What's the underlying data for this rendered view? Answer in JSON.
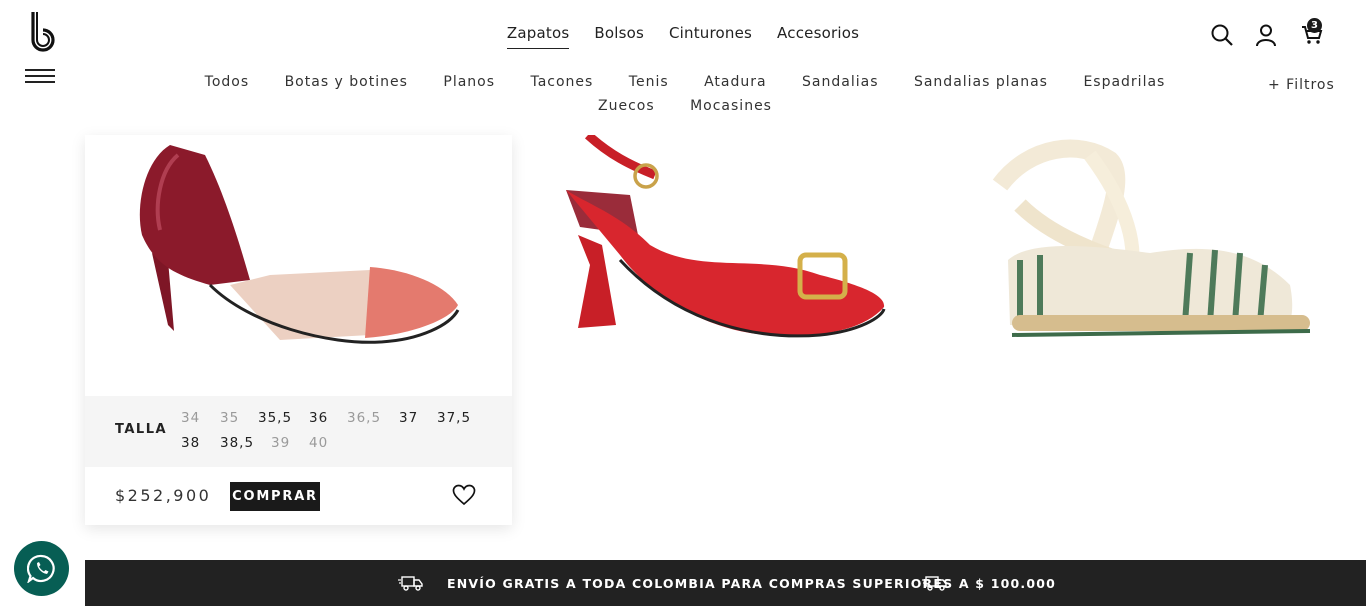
{
  "header": {
    "main_nav": [
      "Zapatos",
      "Bolsos",
      "Cinturones",
      "Accesorios"
    ],
    "active_main": "Zapatos",
    "sub_nav": [
      "Todos",
      "Botas y botines",
      "Planos",
      "Tacones",
      "Tenis",
      "Atadura",
      "Sandalias",
      "Sandalias planas",
      "Espadrilas",
      "Zuecos",
      "Mocasines"
    ],
    "filters_label": "+ Filtros",
    "cart_count": "3",
    "icons": [
      "search-icon",
      "user-icon",
      "cart-icon",
      "menu-icon"
    ]
  },
  "product": {
    "talla_label": "TALLA",
    "sizes": [
      {
        "label": "34",
        "available": false
      },
      {
        "label": "35",
        "available": false
      },
      {
        "label": "35,5",
        "available": true
      },
      {
        "label": "36",
        "available": true
      },
      {
        "label": "36,5",
        "available": false
      },
      {
        "label": "37",
        "available": true
      },
      {
        "label": "37,5",
        "available": true
      },
      {
        "label": "38",
        "available": true
      },
      {
        "label": "38,5",
        "available": true
      },
      {
        "label": "39",
        "available": false
      },
      {
        "label": "40",
        "available": false
      }
    ],
    "price": "$252,900",
    "buy_label": "COMPRAR"
  },
  "banner": {
    "text": "ENVÍO GRATIS A TODA COLOMBIA PARA COMPRAS SUPERIORES A $ 100.000"
  },
  "colors": {
    "banner_bg": "#222222",
    "button_bg": "#1a1a1a",
    "whatsapp": "#075e54",
    "shoe1_patent": "#8b1a2b",
    "shoe1_salmon": "#e47a6e",
    "shoe2_red": "#d8262e",
    "shoe3_green": "#4e7a5a"
  }
}
